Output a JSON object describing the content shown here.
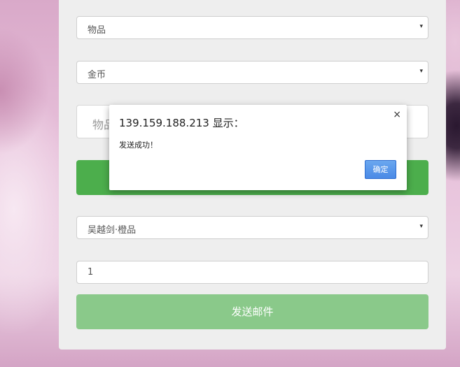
{
  "form": {
    "item_type_select": "物品",
    "currency_select": "金币",
    "item_input_placeholder": "物品",
    "item_select": "吴越剑·橙品",
    "quantity_value": "1",
    "send_button_label": "发送邮件"
  },
  "dialog": {
    "title": "139.159.188.213 显示：",
    "message": "发送成功！",
    "ok_label": "确定",
    "close_glyph": "×"
  },
  "icons": {
    "select_caret": "▾"
  },
  "colors": {
    "primary_green": "#4cae4c",
    "disabled_green": "#8ac98a",
    "dialog_button_blue": "#4a8ae6"
  }
}
